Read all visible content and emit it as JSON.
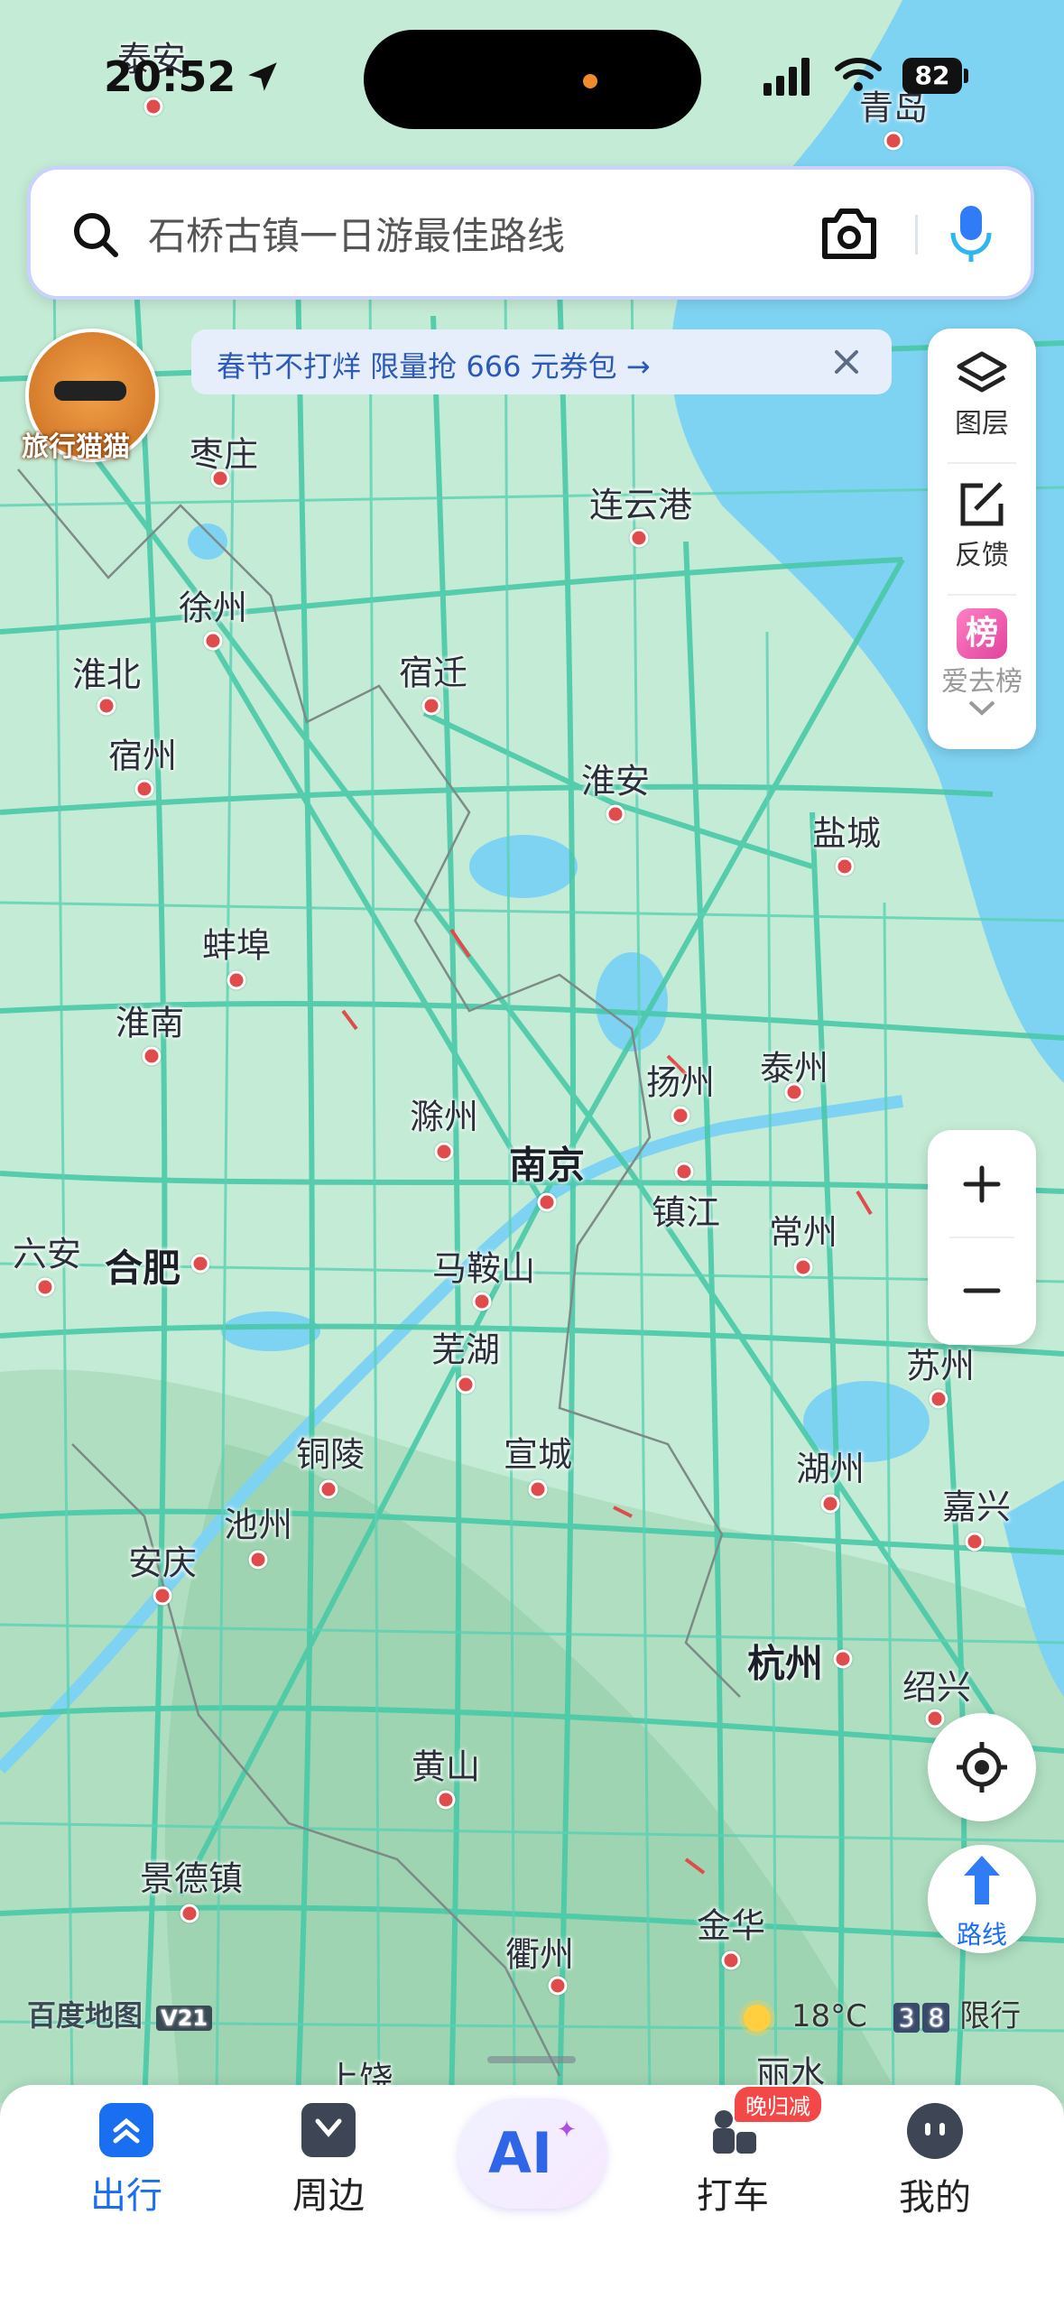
{
  "status_bar": {
    "time": "20:52",
    "battery": "82"
  },
  "search": {
    "placeholder": "石桥古镇一日游最佳路线"
  },
  "promo": {
    "text": "春节不打烊 限量抢 666 元券包 →"
  },
  "mascot": {
    "label": "旅行猫猫"
  },
  "right_toolbar": {
    "layers_label": "图层",
    "feedback_label": "反馈",
    "rank_icon_text": "榜",
    "rank_label": "爱去榜"
  },
  "map": {
    "cities": [
      {
        "name": "枣庄",
        "bold": false
      },
      {
        "name": "连云港",
        "bold": false
      },
      {
        "name": "徐州",
        "bold": false
      },
      {
        "name": "淮北",
        "bold": false
      },
      {
        "name": "宿迁",
        "bold": false
      },
      {
        "name": "宿州",
        "bold": false
      },
      {
        "name": "淮安",
        "bold": false
      },
      {
        "name": "盐城",
        "bold": false
      },
      {
        "name": "蚌埠",
        "bold": false
      },
      {
        "name": "淮南",
        "bold": false
      },
      {
        "name": "扬州",
        "bold": false
      },
      {
        "name": "泰州",
        "bold": false
      },
      {
        "name": "滁州",
        "bold": false
      },
      {
        "name": "南京",
        "bold": true
      },
      {
        "name": "镇江",
        "bold": false
      },
      {
        "name": "常州",
        "bold": false
      },
      {
        "name": "六安",
        "bold": false
      },
      {
        "name": "合肥",
        "bold": true
      },
      {
        "name": "马鞍山",
        "bold": false
      },
      {
        "name": "芜湖",
        "bold": false
      },
      {
        "name": "苏州",
        "bold": false
      },
      {
        "name": "铜陵",
        "bold": false
      },
      {
        "name": "宣城",
        "bold": false
      },
      {
        "name": "湖州",
        "bold": false
      },
      {
        "name": "池州",
        "bold": false
      },
      {
        "name": "嘉兴",
        "bold": false
      },
      {
        "name": "安庆",
        "bold": false
      },
      {
        "name": "杭州",
        "bold": true
      },
      {
        "name": "绍兴",
        "bold": false
      },
      {
        "name": "黄山",
        "bold": false
      },
      {
        "name": "景德镇",
        "bold": false
      },
      {
        "name": "金华",
        "bold": false
      },
      {
        "name": "衢州",
        "bold": false
      },
      {
        "name": "丽水",
        "bold": false
      },
      {
        "name": "上饶",
        "bold": false
      },
      {
        "name": "泰安",
        "bold": false
      },
      {
        "name": "青岛",
        "bold": false
      }
    ],
    "logo": "百度地图",
    "logo_badge": "V21",
    "weather": {
      "temp": "18°C",
      "restriction_digits": [
        "3",
        "8"
      ],
      "restriction_label": "限行"
    }
  },
  "route_button": {
    "label": "路线"
  },
  "bottom_nav": {
    "items": [
      {
        "label": "出行",
        "active": true
      },
      {
        "label": "周边",
        "active": false
      },
      {
        "label": "AI",
        "active": false
      },
      {
        "label": "打车",
        "active": false,
        "badge": "晚归减"
      },
      {
        "label": "我的",
        "active": false
      }
    ]
  },
  "colors": {
    "accent": "#1a6ef0",
    "city_dot": "#e04b4b",
    "road": "#49c9a8",
    "water": "#7fd3f2",
    "land": "#c2ead3"
  }
}
